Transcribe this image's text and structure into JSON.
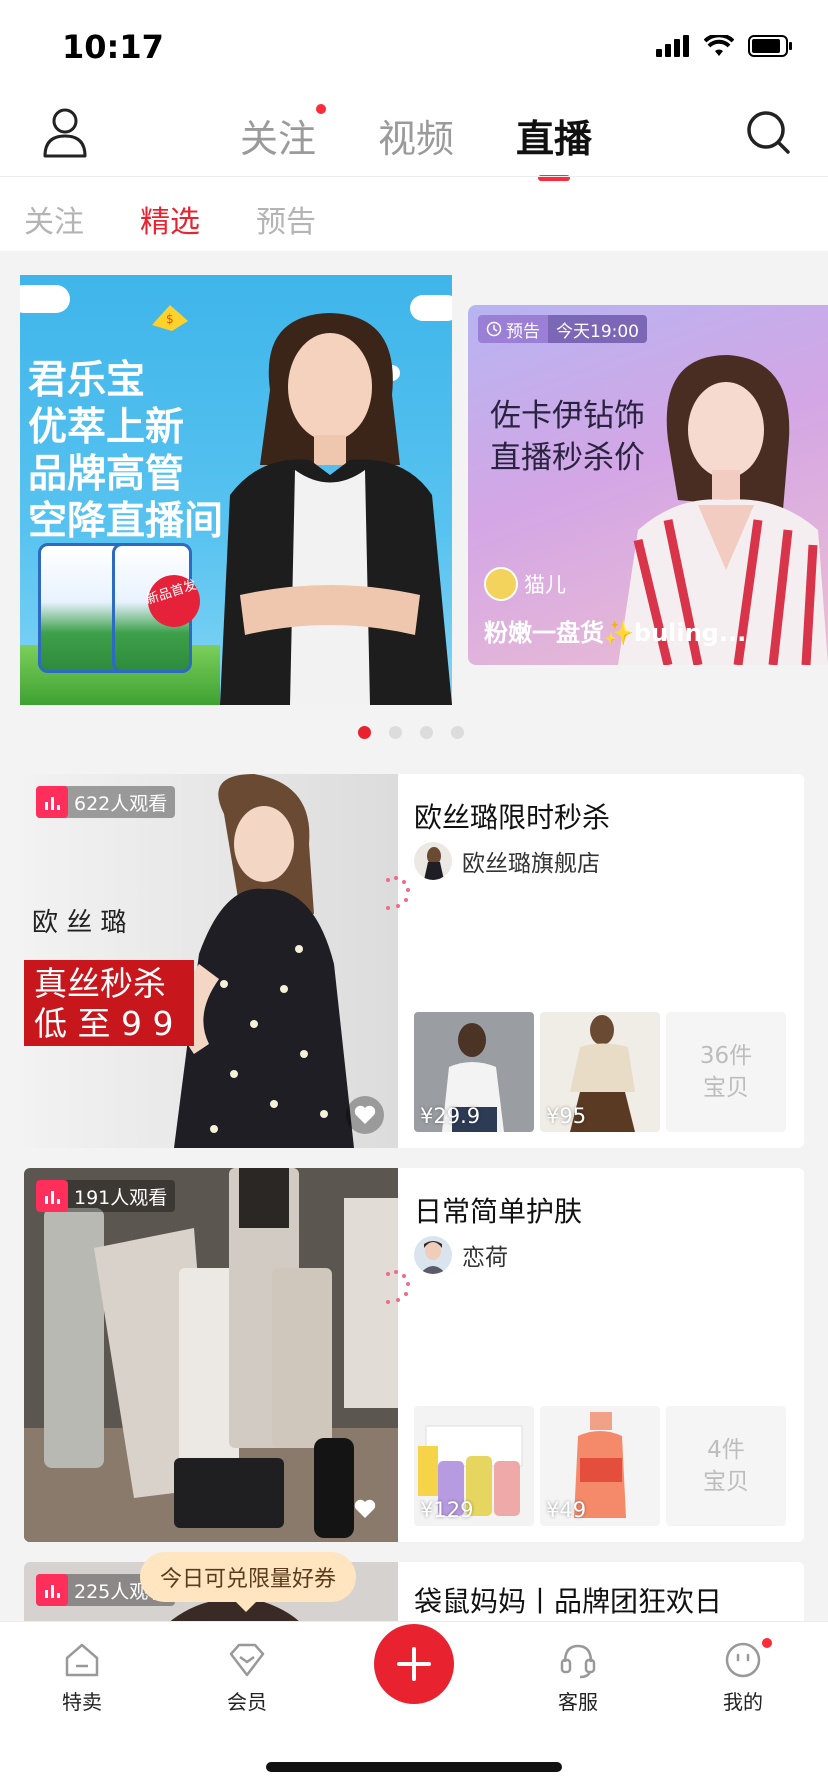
{
  "status_bar": {
    "time": "10:17"
  },
  "header": {
    "tabs": [
      {
        "label": "关注",
        "has_dot": true
      },
      {
        "label": "视频",
        "has_dot": false
      },
      {
        "label": "直播",
        "active": true
      }
    ]
  },
  "sub_tabs": [
    {
      "label": "关注"
    },
    {
      "label": "精选",
      "active": true
    },
    {
      "label": "预告"
    }
  ],
  "banners": {
    "main": {
      "headline_lines": [
        "君乐宝",
        "优萃上新",
        "品牌高管",
        "空降直播间"
      ],
      "badge": "新品首发"
    },
    "side": {
      "tag_label": "预告",
      "tag_time": "今天19:00",
      "headline_lines": [
        "佐卡伊钻饰",
        "直播秒杀价"
      ],
      "anchor_name": "猫儿",
      "title": "粉嫩一盘货✨buling..."
    },
    "page_count": 4,
    "active_index": 0
  },
  "live_cards": [
    {
      "viewers": "622人观看",
      "cover_text_top": "欧 丝 璐",
      "cover_text_red_1": "真丝秒杀",
      "cover_text_red_2": "低 至 9 9",
      "title": "欧丝璐限时秒杀",
      "shop": "欧丝璐旗舰店",
      "products": [
        {
          "price": "¥29.9"
        },
        {
          "price": "¥95"
        }
      ],
      "count_line1": "36件",
      "count_line2": "宝贝"
    },
    {
      "viewers": "191人观看",
      "title": "日常简单护肤",
      "shop": "恋荷",
      "products": [
        {
          "price": "¥129"
        },
        {
          "price": "¥49"
        }
      ],
      "count_line1": "4件",
      "count_line2": "宝贝"
    },
    {
      "viewers": "225人观看",
      "title": "袋鼠妈妈丨品牌团狂欢日"
    }
  ],
  "coupon_tip": "今日可兑限量好券",
  "bottom_nav": [
    {
      "label": "特卖",
      "icon": "home-icon"
    },
    {
      "label": "会员",
      "icon": "diamond-icon"
    },
    {
      "label": "",
      "icon": "plus-icon"
    },
    {
      "label": "客服",
      "icon": "headset-icon"
    },
    {
      "label": "我的",
      "icon": "smiley-icon",
      "has_dot": true
    }
  ],
  "colors": {
    "accent": "#e8232f",
    "live_pink": "#ff2e5a",
    "feed_bg": "#f3f3f3"
  }
}
